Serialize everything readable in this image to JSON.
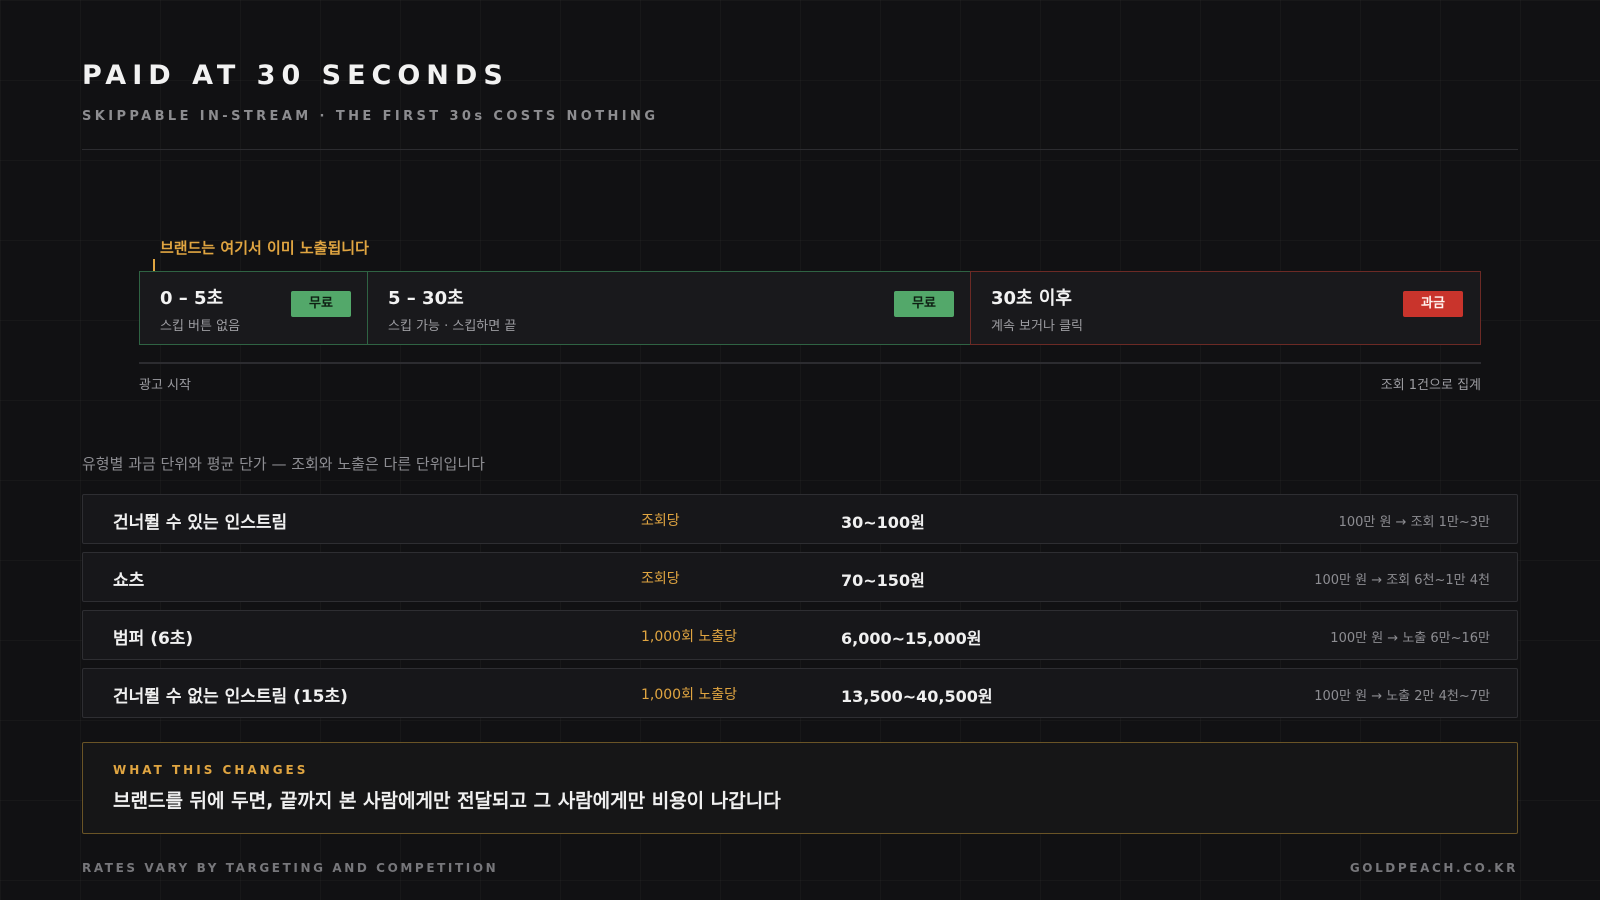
{
  "header": {
    "title": "PAID AT 30 SECONDS",
    "subtitle": "SKIPPABLE IN-STREAM · THE FIRST 30s COSTS NOTHING"
  },
  "timeline": {
    "callout": "브랜드는 여기서 이미 노출됩니다",
    "segments": [
      {
        "time": "0 – 5초",
        "desc": "스킵 버튼 없음",
        "tag": "무료",
        "status": "free"
      },
      {
        "time": "5 – 30초",
        "desc": "스킵 가능 · 스킵하면 끝",
        "tag": "무료",
        "status": "free"
      },
      {
        "time": "30초 이후",
        "desc": "계속 보거나 클릭",
        "tag": "과금",
        "status": "paid"
      }
    ],
    "axis_start": "광고 시작",
    "axis_end": "조회 1건으로 집계"
  },
  "rates": {
    "caption": "유형별 과금 단위와 평균 단가 — 조회와 노출은 다른 단위입니다",
    "rows": [
      {
        "name": "건너뛸 수 있는 인스트림",
        "unit": "조회당",
        "price": "30~100원",
        "note": "100만 원 → 조회 1만~3만"
      },
      {
        "name": "쇼츠",
        "unit": "조회당",
        "price": "70~150원",
        "note": "100만 원 → 조회 6천~1만 4천"
      },
      {
        "name": "범퍼 (6초)",
        "unit": "1,000회 노출당",
        "price": "6,000~15,000원",
        "note": "100만 원 → 노출 6만~16만"
      },
      {
        "name": "건너뛸 수 없는 인스트림 (15초)",
        "unit": "1,000회 노출당",
        "price": "13,500~40,500원",
        "note": "100만 원 → 노출 2만 4천~7만"
      }
    ]
  },
  "changes": {
    "label": "WHAT THIS CHANGES",
    "text": "브랜드를 뒤에 두면, 끝까지 본 사람에게만 전달되고 그 사람에게만 비용이 나갑니다"
  },
  "footer": {
    "left": "RATES VARY BY TARGETING AND COMPETITION",
    "right": "GOLDPEACH.CO.KR"
  },
  "colors": {
    "background": "#111113",
    "accent_gold": "#e0a541",
    "free_green": "#53a86a",
    "paid_red": "#c9342c"
  }
}
